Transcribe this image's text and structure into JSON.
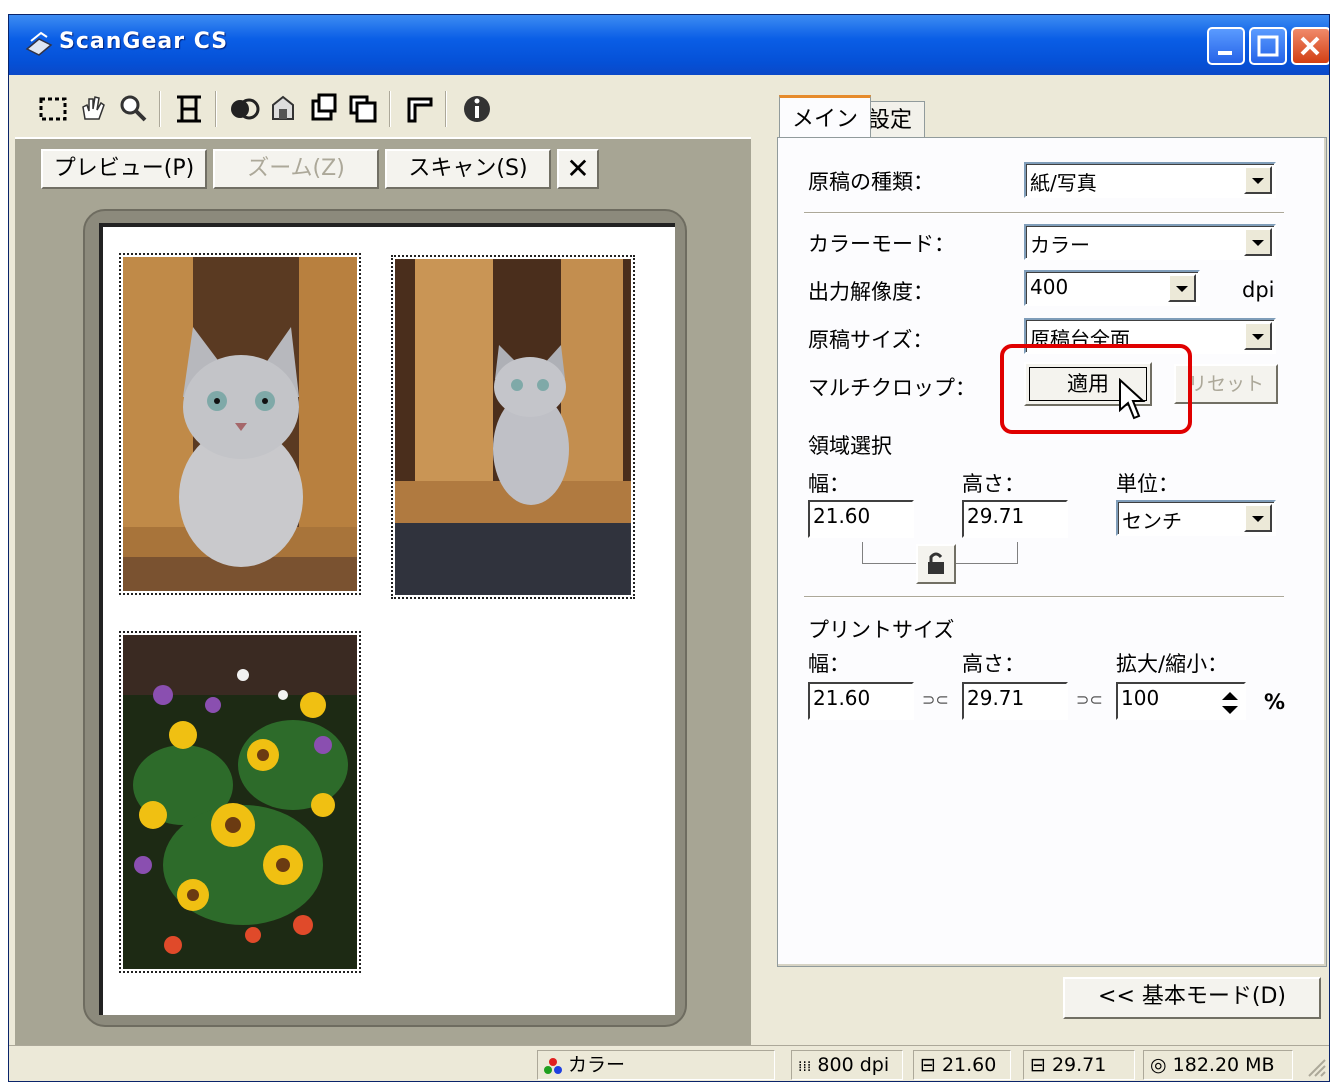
{
  "window": {
    "title": "ScanGear CS"
  },
  "toolbar": {
    "icons": [
      "crop-tool-icon",
      "hand-tool-icon",
      "zoom-tool-icon",
      "auto-crop-icon",
      "color-icon",
      "mirror-icon",
      "rotate-left-icon",
      "rotate-right-icon",
      "corner-icon",
      "info-icon"
    ]
  },
  "actions": {
    "preview": "プレビュー(P)",
    "zoom": "ズーム(Z)",
    "scan": "スキャン(S)",
    "clear": "✕"
  },
  "tabs": {
    "main": "メイン",
    "settings": "設定"
  },
  "form": {
    "source_type_label": "原稿の種類：",
    "source_type_value": "紙/写真",
    "color_mode_label": "カラーモード：",
    "color_mode_value": "カラー",
    "resolution_label": "出力解像度：",
    "resolution_value": "400",
    "dpi_unit": "dpi",
    "doc_size_label": "原稿サイズ：",
    "doc_size_value": "原稿台全面",
    "multicrop_label": "マルチクロップ：",
    "apply_button": "適用",
    "reset_button": "リセット",
    "area_section": "領域選択",
    "width_label": "幅：",
    "height_label": "高さ：",
    "unit_label": "単位：",
    "width_value": "21.60",
    "height_value": "29.71",
    "unit_value": "センチ",
    "print_section": "プリントサイズ",
    "print_width_label": "幅：",
    "print_height_label": "高さ：",
    "scale_label": "拡大/縮小：",
    "print_width_value": "21.60",
    "print_height_value": "29.71",
    "scale_value": "100",
    "percent": "%",
    "link1": "⊃⊂",
    "link2": "⊃⊂"
  },
  "basic_mode_button": "<< 基本モード(D)",
  "status": {
    "color": "カラー",
    "dpi": "800 dpi",
    "width": "21.60",
    "height": "29.71",
    "size": "182.20 MB"
  },
  "highlight_color": "#e00000"
}
